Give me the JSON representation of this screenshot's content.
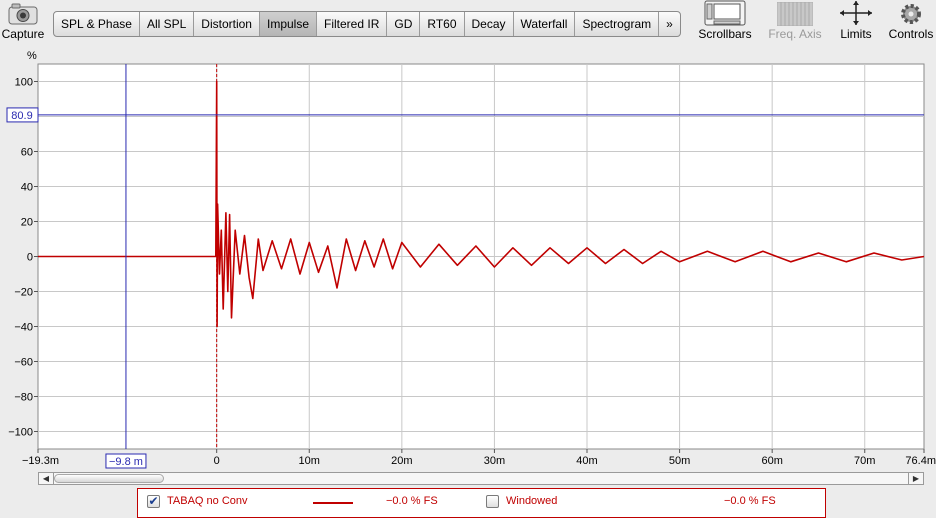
{
  "toolbar": {
    "capture": "Capture",
    "tabs": [
      "SPL & Phase",
      "All SPL",
      "Distortion",
      "Impulse",
      "Filtered IR",
      "GD",
      "RT60",
      "Decay",
      "Waterfall",
      "Spectrogram"
    ],
    "active_tab": "Impulse",
    "more": "»",
    "scrollbars": "Scrollbars",
    "freq_axis": "Freq. Axis",
    "limits": "Limits",
    "controls": "Controls"
  },
  "plot": {
    "y_unit": "%",
    "y_ticks": [
      "100",
      "80",
      "60",
      "40",
      "20",
      "0",
      "−20",
      "−40",
      "−60",
      "−80",
      "−100"
    ],
    "x_ticks": [
      "−19.3m",
      "0",
      "10m",
      "20m",
      "30m",
      "40m",
      "50m",
      "60m",
      "70m",
      "76.4m"
    ],
    "cursor_x_label": "−9.8 m",
    "cursor_y_label": "80.9",
    "colors": {
      "trace": "#c00000",
      "cursor": "#2a2ab0",
      "grid": "#c8c8c8"
    }
  },
  "chart_data": {
    "type": "line",
    "xlabel": "",
    "ylabel": "%",
    "xlim": [
      -19.3,
      76.4
    ],
    "ylim": [
      -110,
      110
    ],
    "x_unit": "ms",
    "grid": true,
    "cursor": {
      "x": -9.8,
      "y": 80.9
    },
    "marker_x": 0,
    "series": [
      {
        "name": "TABAQ no Conv",
        "x": [
          -19.3,
          -0.1,
          0,
          0.05,
          0.1,
          0.3,
          0.5,
          0.7,
          1.0,
          1.2,
          1.4,
          1.6,
          2.0,
          2.5,
          3.0,
          3.5,
          3.9,
          4.5,
          5.0,
          6.0,
          7.0,
          8.0,
          9.0,
          10.0,
          11.0,
          12.0,
          13.0,
          14.0,
          15.0,
          16.0,
          17.0,
          18.0,
          19.0,
          20.0,
          22.0,
          24.0,
          26.0,
          28.0,
          30.0,
          32.0,
          34.0,
          36.0,
          38.0,
          40.0,
          42.0,
          44.0,
          46.0,
          48.0,
          50.0,
          53.0,
          56.0,
          59.0,
          62.0,
          65.0,
          68.0,
          71.0,
          74.0,
          76.4
        ],
        "values": [
          0,
          0,
          100,
          -40,
          30,
          -10,
          15,
          -30,
          25,
          -20,
          24,
          -35,
          15,
          -10,
          12,
          -12,
          -24,
          10,
          -8,
          9,
          -7,
          10,
          -10,
          8,
          -9,
          6,
          -18,
          10,
          -8,
          9,
          -6,
          10,
          -7,
          8,
          -6,
          7,
          -5,
          6,
          -6,
          5,
          -5,
          5,
          -4,
          5,
          -4,
          4,
          -4,
          3,
          -3,
          3,
          -3,
          3,
          -3,
          2,
          -3,
          2,
          -2,
          0
        ]
      }
    ]
  },
  "scrollbar": {
    "left_arrow": "◀",
    "right_arrow": "▶"
  },
  "legend": {
    "trace_name": "TABAQ no Conv",
    "trace_checked": true,
    "trace_value": "−0.0 % FS",
    "windowed_label": "Windowed",
    "windowed_checked": false,
    "windowed_value": "−0.0 % FS"
  }
}
